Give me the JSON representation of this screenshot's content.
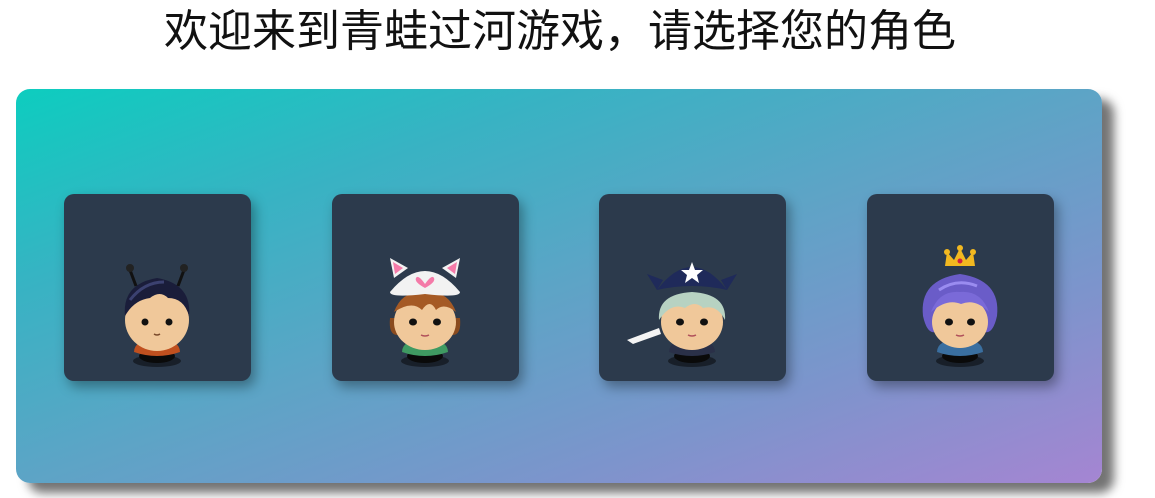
{
  "page": {
    "title": "欢迎来到青蛙过河游戏，请选择您的角色"
  },
  "characters": [
    {
      "icon": "boy-black-hair-character-icon"
    },
    {
      "icon": "girl-cat-hat-character-icon"
    },
    {
      "icon": "pirate-character-icon"
    },
    {
      "icon": "princess-crown-character-icon"
    }
  ]
}
